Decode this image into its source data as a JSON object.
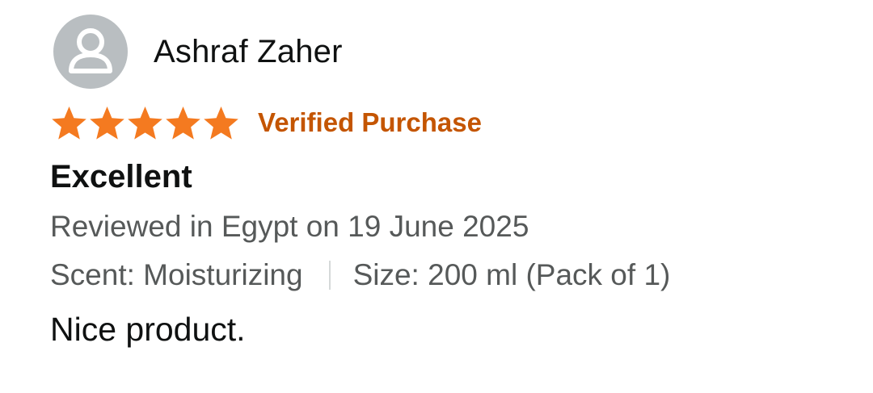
{
  "reviewer": {
    "name": "Ashraf Zaher",
    "avatar_icon": "person-icon"
  },
  "rating": {
    "stars": 5,
    "max_stars": 5,
    "star_color": "#f47a20",
    "star_icon": "star-icon"
  },
  "badge": {
    "verified_label": "Verified Purchase",
    "color": "#c45500"
  },
  "review": {
    "title": "Excellent",
    "reviewed_line": "Reviewed in Egypt on 19 June 2025",
    "scent": "Scent: Moisturizing",
    "size": "Size: 200 ml (Pack of 1)",
    "body": "Nice product."
  }
}
